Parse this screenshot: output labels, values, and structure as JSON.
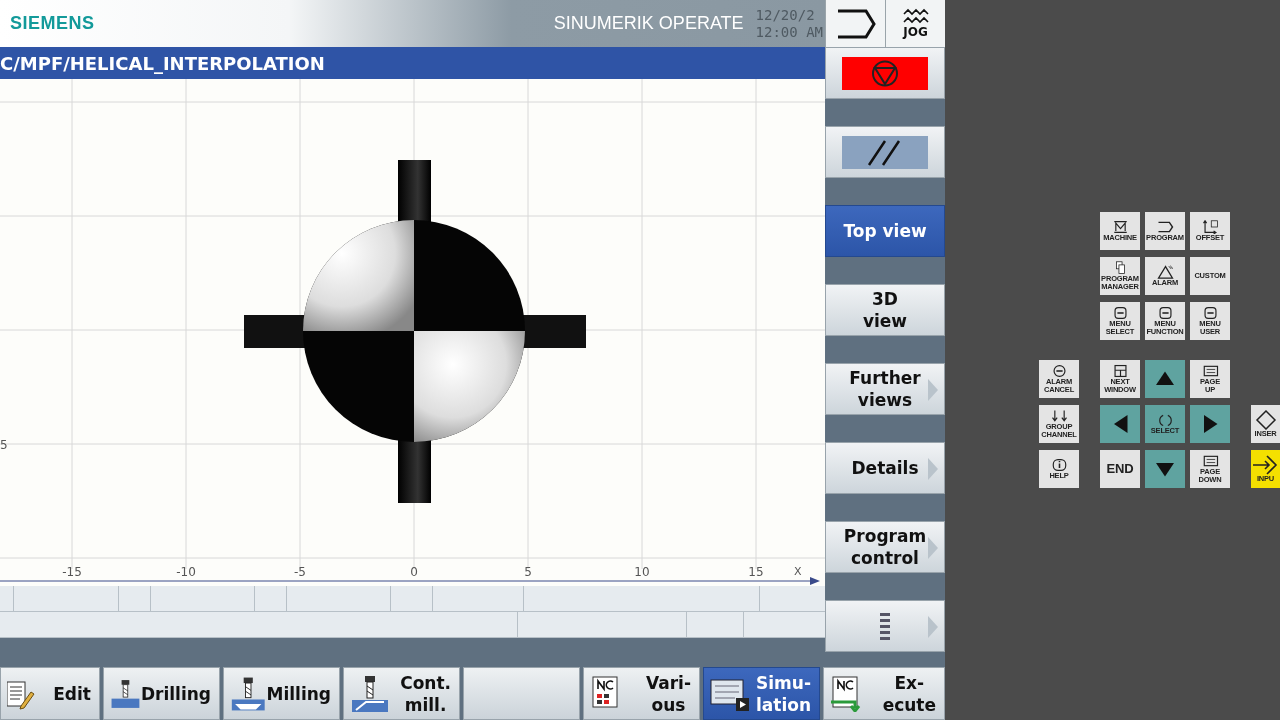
{
  "header": {
    "logo": "SIEMENS",
    "product": "SINUMERIK OPERATE",
    "date": "12/20/2",
    "time": "12:00 AM",
    "mode": "JOG"
  },
  "path": "C/MPF/HELICAL_INTERPOLATION",
  "view": {
    "x_ticks": [
      "-15",
      "-10",
      "-5",
      "0",
      "5",
      "10",
      "15"
    ],
    "y_tick": "5",
    "x_axis": "X"
  },
  "vertical_softkeys": [
    {
      "kind": "stop",
      "selected": false,
      "arrow": false
    },
    {
      "kind": "slash",
      "selected": false,
      "arrow": false
    },
    {
      "kind": "text",
      "label": "Top view",
      "selected": true,
      "arrow": false
    },
    {
      "kind": "text",
      "label": "3D\nview",
      "selected": false,
      "arrow": false
    },
    {
      "kind": "text",
      "label": "Further\nviews",
      "selected": false,
      "arrow": true
    },
    {
      "kind": "text",
      "label": "Details",
      "selected": false,
      "arrow": true
    },
    {
      "kind": "text",
      "label": "Program\ncontrol",
      "selected": false,
      "arrow": true
    },
    {
      "kind": "more",
      "selected": false,
      "arrow": true
    }
  ],
  "bottom_softkeys": [
    {
      "kind": "edit",
      "label": "Edit",
      "selected": false
    },
    {
      "kind": "drill",
      "label": "Drilling",
      "selected": false
    },
    {
      "kind": "mill",
      "label": "Milling",
      "selected": false
    },
    {
      "kind": "contour",
      "label": "Cont.\nmill.",
      "selected": false
    },
    {
      "kind": "empty",
      "selected": false
    },
    {
      "kind": "nc",
      "label": "Vari-\nous",
      "selected": false
    },
    {
      "kind": "sim",
      "label": "Simu-\nlation",
      "selected": true
    },
    {
      "kind": "execute",
      "label": "Ex-\necute",
      "selected": false
    }
  ],
  "keypad": {
    "top_keys": [
      {
        "kind": "machine",
        "label": "MACHINE"
      },
      {
        "kind": "program",
        "label": "PROGRAM"
      },
      {
        "kind": "offset",
        "label": "OFFSET"
      },
      {
        "kind": "manager",
        "label": "PROGRAM\nMANAGER"
      },
      {
        "kind": "alarm",
        "label": "ALARM"
      },
      {
        "kind": "plain",
        "label": "CUSTOM"
      },
      {
        "kind": "menu",
        "label": "MENU\nSELECT"
      },
      {
        "kind": "menu",
        "label": "MENU\nFUNCTION"
      },
      {
        "kind": "menu",
        "label": "MENU\nUSER"
      }
    ],
    "left_keys": [
      {
        "kind": "cancel",
        "label": "ALARM\nCANCEL"
      },
      {
        "kind": "channel",
        "label": "GROUP\nCHANNEL"
      },
      {
        "kind": "help",
        "label": "HELP"
      }
    ],
    "center_keys": [
      {
        "kind": "window",
        "label": "NEXT\nWINDOW"
      },
      {
        "kind": "up"
      },
      {
        "kind": "pageup",
        "label": "PAGE\nUP"
      },
      {
        "kind": "left"
      },
      {
        "kind": "select",
        "label": "SELECT"
      },
      {
        "kind": "right"
      },
      {
        "kind": "end",
        "label": "END"
      },
      {
        "kind": "down"
      },
      {
        "kind": "pagedown",
        "label": "PAGE\nDOWN"
      }
    ],
    "edge_keys": [
      {
        "kind": "insert",
        "label": "INSER"
      },
      {
        "kind": "input",
        "label": "INPU"
      }
    ]
  }
}
